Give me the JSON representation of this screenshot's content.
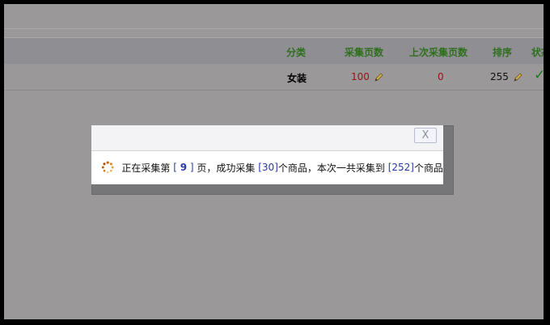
{
  "table": {
    "headers": {
      "category": "分类",
      "pages": "采集页数",
      "last_pages": "上次采集页数",
      "order": "排序",
      "status": "状态"
    },
    "row": {
      "category": "女装",
      "pages": "100",
      "last_pages": "0",
      "order": "255"
    }
  },
  "dialog": {
    "close_label": "X",
    "msg": {
      "prefix": "正在采集第",
      "page_value": "9",
      "middle1": "页，成功采集",
      "success_value": "30",
      "middle2": "个商品，本次一共采集到",
      "total_value": "252",
      "suffix": "个商品"
    }
  },
  "colors": {
    "header_text": "#2e6f1c",
    "highlight_number": "#2a3aa0",
    "red_value": "#9c1010"
  }
}
